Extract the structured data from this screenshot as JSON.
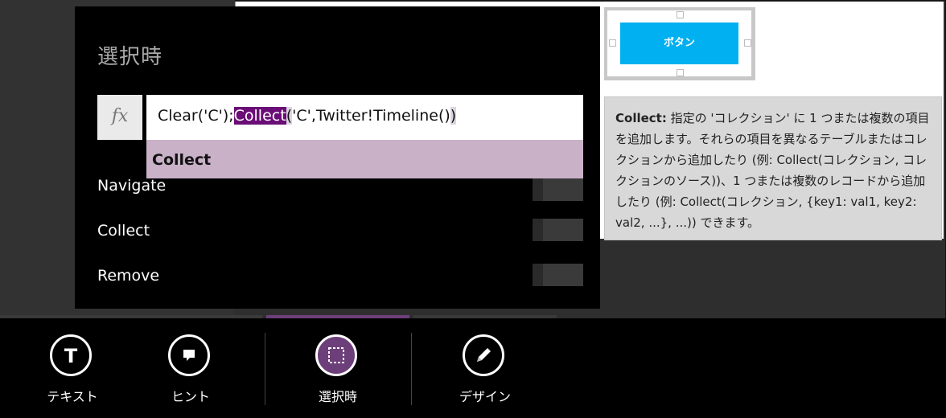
{
  "popup": {
    "title": "選択時",
    "fx_label": "fx",
    "formula": {
      "prefix": "Clear('C');",
      "highlight": "Collect",
      "open_paren": "(",
      "middle": "'C',Twitter!Timeline()",
      "close_paren": ")"
    },
    "suggestion": "Collect",
    "rows": [
      {
        "label": "Navigate"
      },
      {
        "label": "Collect"
      },
      {
        "label": "Remove"
      }
    ]
  },
  "canvas": {
    "button_label": "ボタン"
  },
  "tooltip": {
    "keyword": "Collect:",
    "body": " 指定の 'コレクション' に 1 つまたは複数の項目を追加します。それらの項目を異なるテーブルまたはコレクションから追加したり (例: Collect(コレクション, コレクションのソース))、1 つまたは複数のレコードから追加したり (例: Collect(コレクション, {key1: val1, key2: val2, ...}, ...)) できます。"
  },
  "toolbar": {
    "items": [
      {
        "label": "テキスト",
        "icon": "text-icon"
      },
      {
        "label": "ヒント",
        "icon": "hint-icon"
      },
      {
        "label": "選択時",
        "icon": "selection-icon",
        "active": true
      },
      {
        "label": "デザイン",
        "icon": "design-pencil-icon"
      }
    ]
  },
  "colors": {
    "accent_purple": "#6a0d76",
    "active_circle": "#6d3f7a",
    "suggestion_bg": "#c9b1c8",
    "button_blue": "#00b0f0"
  }
}
